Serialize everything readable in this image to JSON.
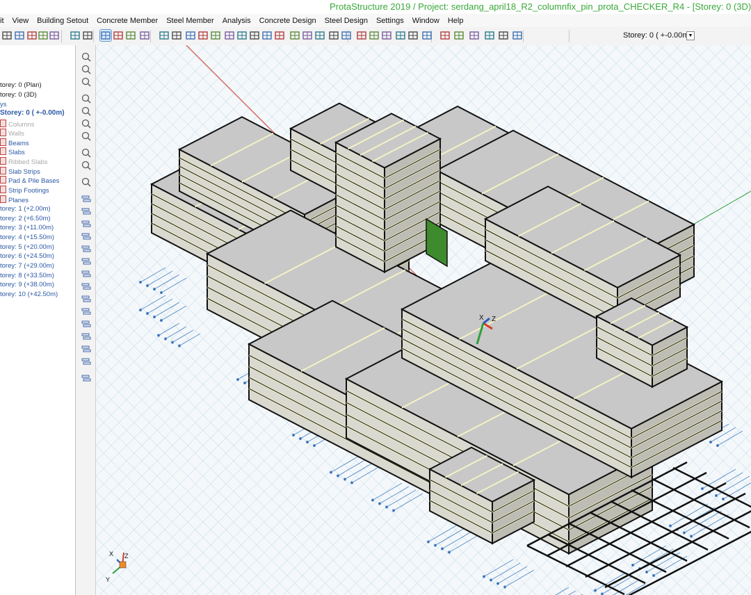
{
  "title": "ProtaStructure 2019 / Project: serdang_april18_R2_columnfix_pin_prota_CHECKER_R4 - [Storey: 0 (3D)]",
  "menu": [
    "it",
    "View",
    "Building Setout",
    "Concrete Member",
    "Steel Member",
    "Analysis",
    "Concrete Design",
    "Steel Design",
    "Settings",
    "Window",
    "Help"
  ],
  "toolbar": {
    "storey_selector": "Storey: 0 ( +-0.00m)",
    "icons": [
      "open-icon",
      "print-icon",
      "print-preview-icon",
      "report-icon",
      "export-icon",
      "undo-icon",
      "redo-icon",
      "select-icon",
      "pick-icon",
      "window-select-icon",
      "delete-icon",
      "pointer-icon",
      "line-icon",
      "grid-icon",
      "dimension-icon",
      "column-icon",
      "wall-icon",
      "beam-icon",
      "slab-icon",
      "opening-icon",
      "stair-icon",
      "load-icon",
      "foundation-icon",
      "settings-icon",
      "axis-icon",
      "level-icon",
      "table-icon",
      "render-icon",
      "section-icon",
      "view-icon",
      "check-icon",
      "analysis-icon",
      "design-icon",
      "checker-icon",
      "pattern-icon",
      "schedule-icon",
      "properties-icon",
      "zoom-menu-icon"
    ]
  },
  "tree": {
    "items": [
      {
        "label": "",
        "style": "plain"
      },
      {
        "label": "torey: 0 (Plan)",
        "style": "plain"
      },
      {
        "label": "torey: 0 (3D)",
        "style": "plain"
      },
      {
        "label": "ys",
        "style": "blue"
      },
      {
        "label": "Storey: 0 ( +-0.00m)",
        "style": "bold"
      },
      {
        "label": "Columns",
        "style": "grey-leaf"
      },
      {
        "label": "Walls",
        "style": "grey-leaf"
      },
      {
        "label": "Beams",
        "style": "leaf"
      },
      {
        "label": "Slabs",
        "style": "leaf"
      },
      {
        "label": "Ribbed Slabs",
        "style": "grey-leaf"
      },
      {
        "label": "Slab Strips",
        "style": "leaf"
      },
      {
        "label": "Pad & Pile Bases",
        "style": "leaf"
      },
      {
        "label": "Strip Footings",
        "style": "leaf"
      },
      {
        "label": "Planes",
        "style": "leaf"
      },
      {
        "label": "torey: 1 (+2.00m)",
        "style": "blue"
      },
      {
        "label": "torey: 2 (+6.50m)",
        "style": "blue"
      },
      {
        "label": "torey: 3 (+11.00m)",
        "style": "blue"
      },
      {
        "label": "torey: 4 (+15.50m)",
        "style": "blue"
      },
      {
        "label": "torey: 5 (+20.00m)",
        "style": "blue"
      },
      {
        "label": "torey: 6 (+24.50m)",
        "style": "blue"
      },
      {
        "label": "torey: 7 (+29.00m)",
        "style": "blue"
      },
      {
        "label": "torey: 8 (+33.50m)",
        "style": "blue"
      },
      {
        "label": "torey: 9 (+38.00m)",
        "style": "blue"
      },
      {
        "label": "torey: 10 (+42.50m)",
        "style": "blue"
      }
    ]
  },
  "left_toolbar": {
    "icons": [
      "pencil-icon",
      "globe-icon",
      "axis-tool-icon",
      "zoom-in-icon",
      "rotate-icon",
      "zoom-window-icon",
      "zoom-all-icon",
      "arrow-tool-icon",
      "copy-view-icon",
      "section-cut-icon",
      "storey-icon",
      "storey-icon",
      "storey-icon",
      "storey-icon",
      "storey-icon",
      "storey-icon",
      "storey-icon",
      "storey-icon",
      "storey-icon",
      "storey-icon",
      "storey-icon",
      "storey-icon",
      "storey-icon",
      "storey-icon",
      "storey-icon"
    ]
  },
  "viewport": {
    "axis_labels": {
      "x": "X",
      "y": "Y",
      "z": "Z"
    },
    "colors": {
      "slab": "#c8c8c8",
      "frame": "#111111",
      "beam_highlight": "#f4f2c4",
      "grid": "#c9dcea",
      "green_wall": "#3d8b2d",
      "axis_red": "#d63a2a",
      "axis_green": "#2f9e3a",
      "axis_blue": "#2a58b8"
    }
  }
}
